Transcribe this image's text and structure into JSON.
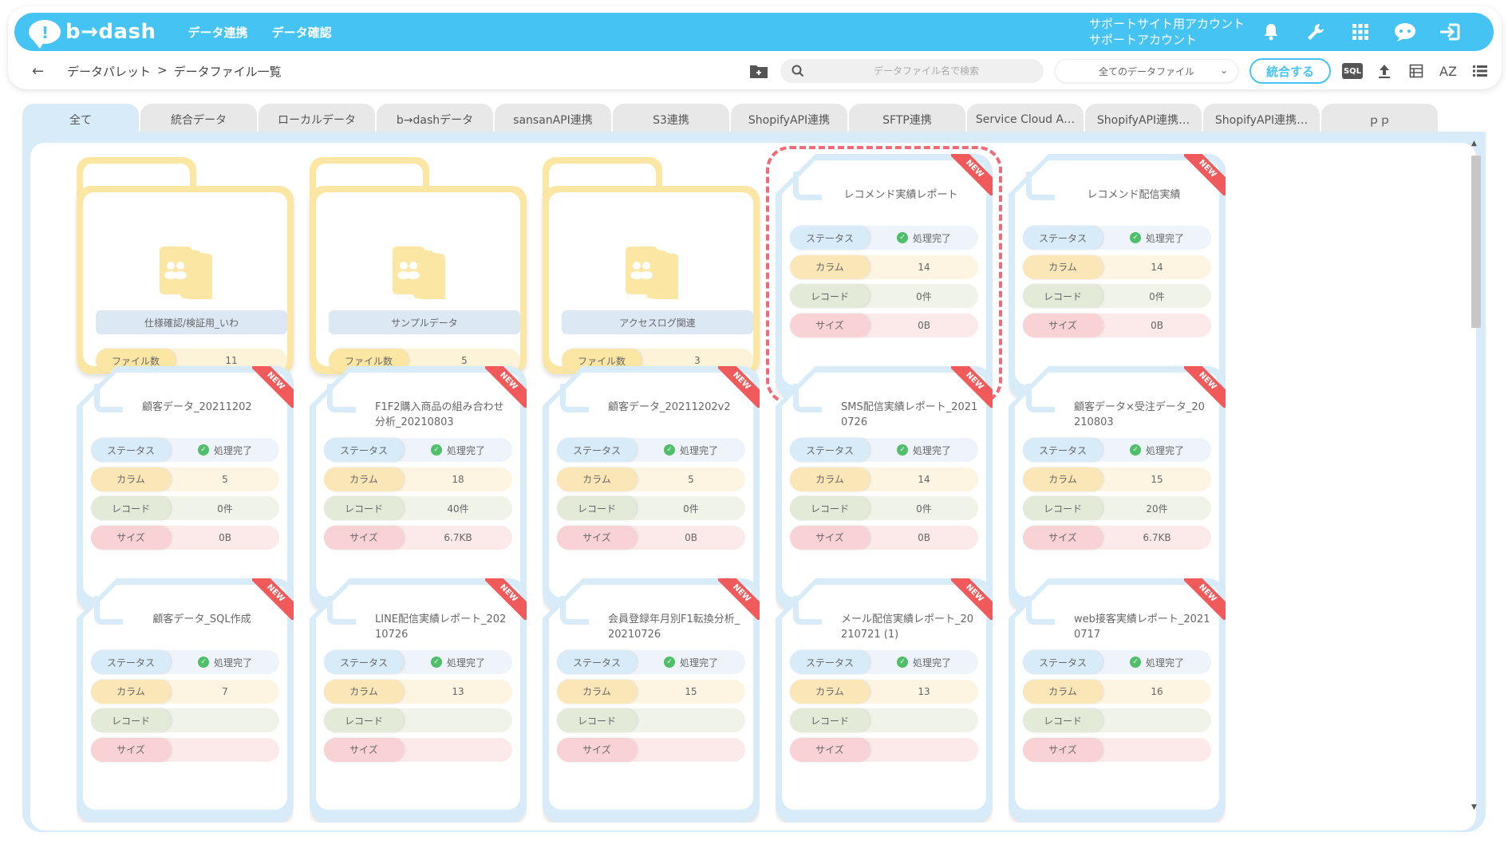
{
  "header": {
    "logo_text": "b→dash",
    "nav": [
      "データ連携",
      "データ確認"
    ],
    "account_line1": "サポートサイト用アカウント",
    "account_line2": "サポートアカウント"
  },
  "breadcrumb": {
    "items": [
      "データパレット",
      ">",
      "データファイル一覧"
    ]
  },
  "toolbar": {
    "search_placeholder": "データファイル名で検索",
    "filter_value": "全てのデータファイル",
    "merge_label": "統合する",
    "sql_label": "SQL",
    "sort_label": "AZ"
  },
  "tabs": [
    {
      "label": "全て"
    },
    {
      "label": "統合データ"
    },
    {
      "label": "ローカルデータ"
    },
    {
      "label": "b→dashデータ"
    },
    {
      "label": "sansanAPI連携"
    },
    {
      "label": "S3連携"
    },
    {
      "label": "ShopifyAPI連携"
    },
    {
      "label": "SFTP連携"
    },
    {
      "label": "Service Cloud A…"
    },
    {
      "label": "ShopifyAPI連携…"
    },
    {
      "label": "ShopifyAPI連携…"
    },
    {
      "label": "ｐｐ"
    }
  ],
  "labels": {
    "file_count": "ファイル数",
    "status": "ステータス",
    "column": "カラム",
    "record": "レコード",
    "size": "サイズ",
    "new_badge": "NEW",
    "done": "処理完了"
  },
  "folders": [
    {
      "name": "仕様確認/検証用_いわ",
      "count": "11"
    },
    {
      "name": "サンプルデータ",
      "count": "5"
    },
    {
      "name": "アクセスログ関連",
      "count": "3"
    }
  ],
  "files": [
    {
      "title": "レコメンド実績レポート",
      "columns": "14",
      "records": "0件",
      "size": "0B"
    },
    {
      "title": "レコメンド配信実績",
      "columns": "14",
      "records": "0件",
      "size": "0B"
    },
    {
      "title": "顧客データ_20211202",
      "columns": "5",
      "records": "0件",
      "size": "0B"
    },
    {
      "title": "F1F2購入商品の組み合わせ分析_20210803",
      "columns": "18",
      "records": "40件",
      "size": "6.7KB"
    },
    {
      "title": "顧客データ_20211202v2",
      "columns": "5",
      "records": "0件",
      "size": "0B"
    },
    {
      "title": "SMS配信実績レポート_20210726",
      "columns": "14",
      "records": "0件",
      "size": "0B"
    },
    {
      "title": "顧客データ×受注データ_20210803",
      "columns": "15",
      "records": "20件",
      "size": "6.7KB"
    },
    {
      "title": "顧客データ_SQL作成",
      "columns": "7",
      "records": "",
      "size": ""
    },
    {
      "title": "LINE配信実績レポート_20210726",
      "columns": "13",
      "records": "",
      "size": ""
    },
    {
      "title": "会員登録年月別F1転換分析_20210726",
      "columns": "15",
      "records": "",
      "size": ""
    },
    {
      "title": "メール配信実績レポート_20210721 (1)",
      "columns": "13",
      "records": "",
      "size": ""
    },
    {
      "title": "web接客実績レポート_20210717",
      "columns": "16",
      "records": "",
      "size": ""
    }
  ],
  "colors": {
    "accent": "#45c4f4",
    "folder": "#fbe6a4",
    "file": "#d7ebf8",
    "new": "#f05a5a",
    "selected_outline": "#ef6b78"
  }
}
